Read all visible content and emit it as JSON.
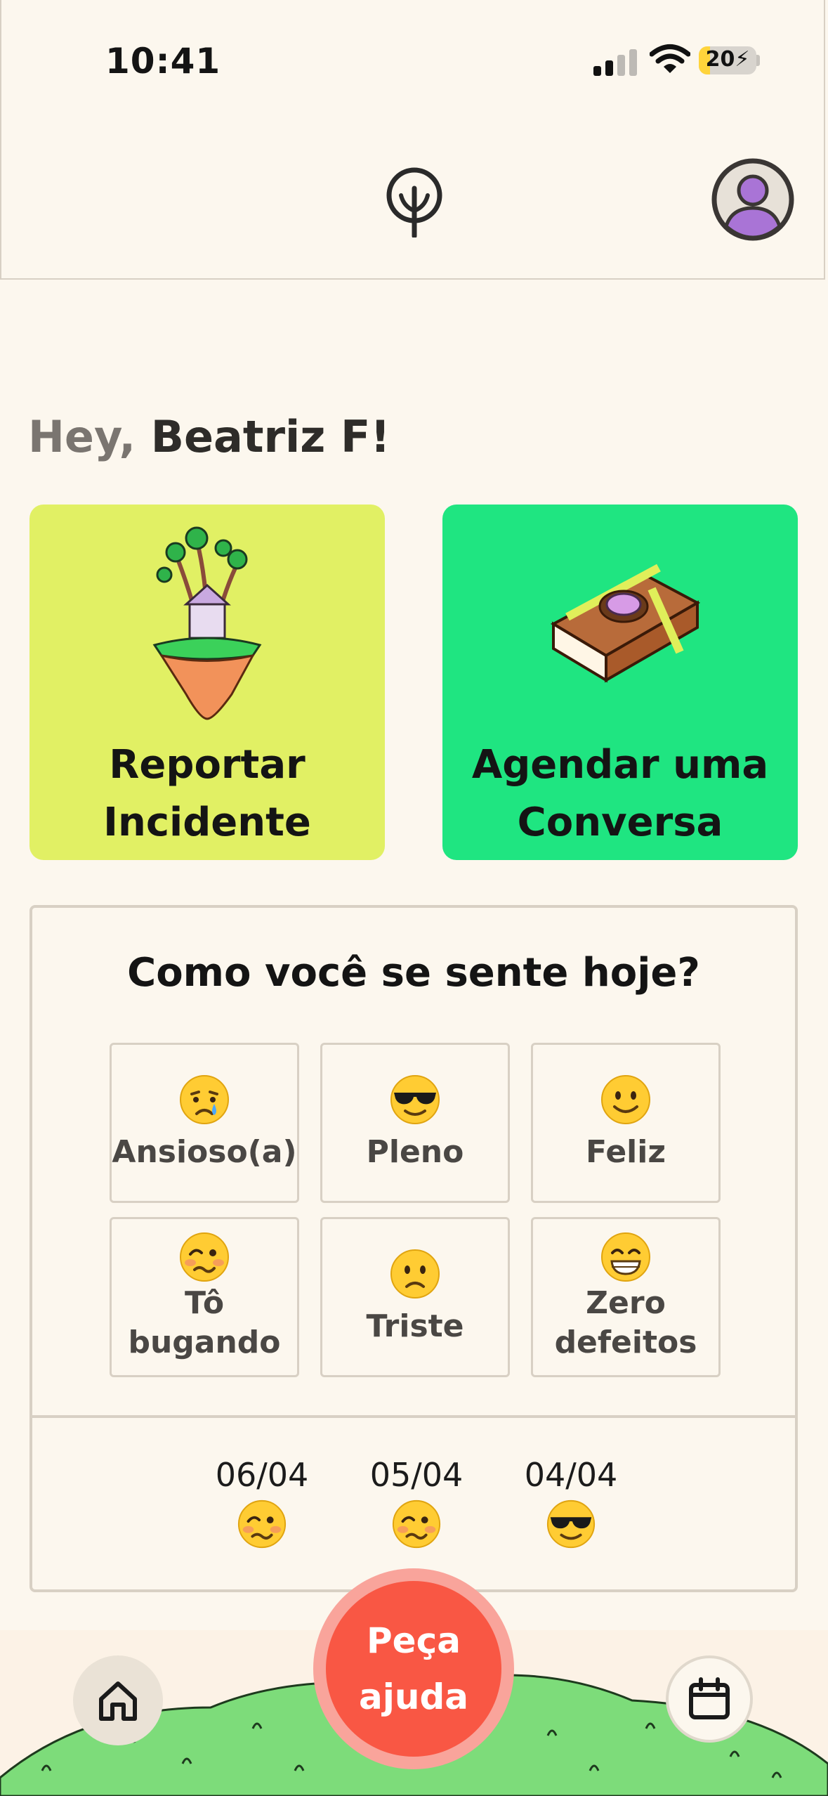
{
  "status_bar": {
    "time": "10:41",
    "battery": "20"
  },
  "header": {
    "logo_icon": "tree-icon",
    "avatar_icon": "user-avatar-icon"
  },
  "greeting": {
    "hey": "Hey,",
    "name": "Beatriz F!"
  },
  "cards": [
    {
      "label_line1": "Reportar",
      "label_line2": "Incidente",
      "color": "#e1f064",
      "illustration": "floating-island-house"
    },
    {
      "label_line1": "Agendar uma",
      "label_line2": "Conversa",
      "color": "#1fe581",
      "illustration": "brain-book"
    }
  ],
  "mood": {
    "question": "Como você se sente hoje?",
    "options": [
      {
        "label": "Ansioso(a)",
        "emoji": "crying-face"
      },
      {
        "label": "Pleno",
        "emoji": "sunglasses-face"
      },
      {
        "label": "Feliz",
        "emoji": "smiling-face"
      },
      {
        "label_line1": "Tô",
        "label_line2": "bugando",
        "emoji": "woozy-face"
      },
      {
        "label": "Triste",
        "emoji": "sad-face"
      },
      {
        "label_line1": "Zero",
        "label_line2": "defeitos",
        "emoji": "grinning-face"
      }
    ],
    "history": [
      {
        "date": "06/04",
        "emoji": "woozy-face"
      },
      {
        "date": "05/04",
        "emoji": "woozy-face"
      },
      {
        "date": "04/04",
        "emoji": "sunglasses-face"
      }
    ]
  },
  "bottom_nav": {
    "help_line1": "Peça",
    "help_line2": "ajuda",
    "help_color": "#f95744",
    "home_icon": "home-icon",
    "calendar_icon": "calendar-icon"
  }
}
